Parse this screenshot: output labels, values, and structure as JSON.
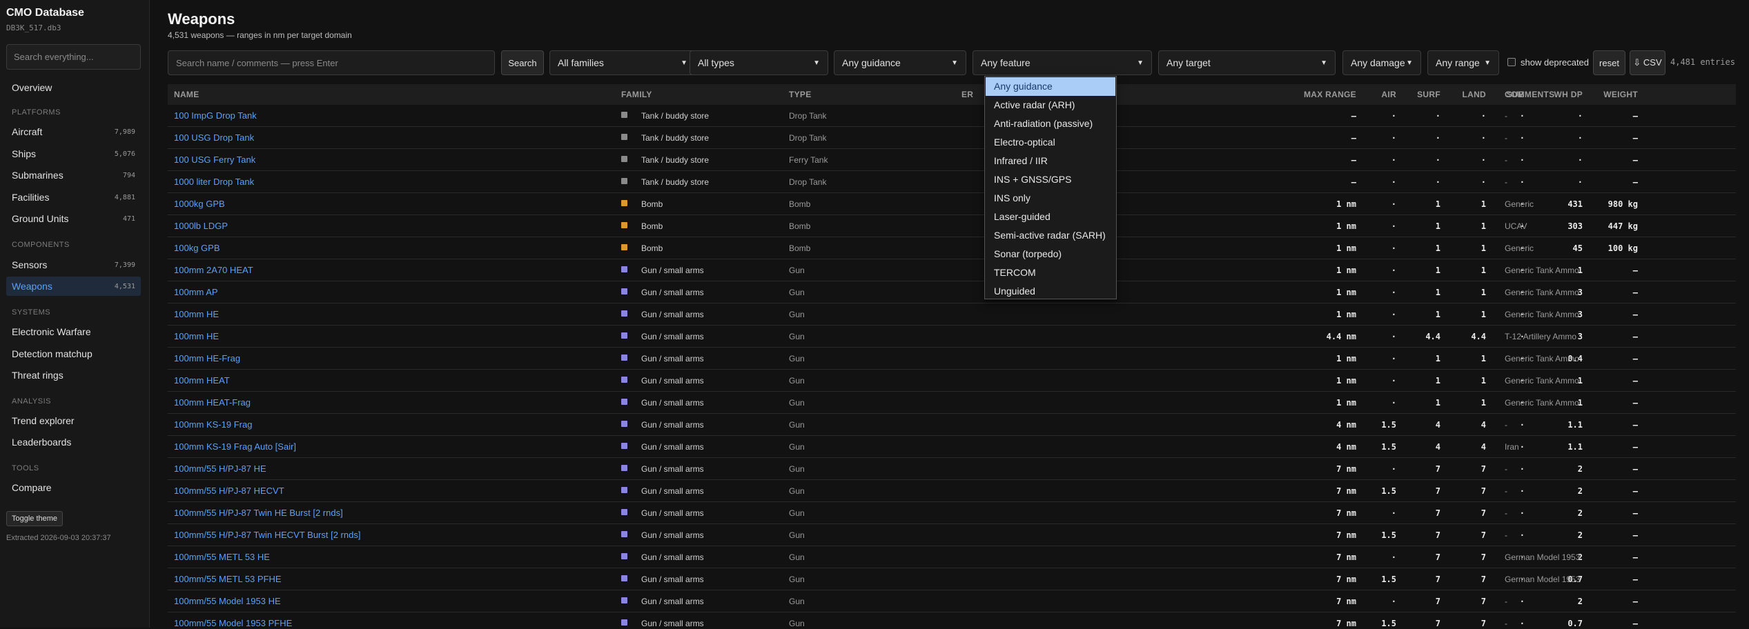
{
  "sidebar": {
    "title": "CMO Database",
    "db_file": "DB3K_517.db3",
    "search_placeholder": "Search everything...",
    "overview": "Overview",
    "sections": {
      "platforms": "PLATFORMS",
      "components": "COMPONENTS",
      "systems": "SYSTEMS",
      "analysis": "ANALYSIS",
      "tools": "TOOLS"
    },
    "items": {
      "aircraft": {
        "label": "Aircraft",
        "count": "7,989"
      },
      "ships": {
        "label": "Ships",
        "count": "5,076"
      },
      "submarines": {
        "label": "Submarines",
        "count": "794"
      },
      "facilities": {
        "label": "Facilities",
        "count": "4,881"
      },
      "ground_units": {
        "label": "Ground Units",
        "count": "471"
      },
      "sensors": {
        "label": "Sensors",
        "count": "7,399"
      },
      "weapons": {
        "label": "Weapons",
        "count": "4,531"
      },
      "electronic_warfare": {
        "label": "Electronic Warfare"
      },
      "detection_matchup": {
        "label": "Detection matchup"
      },
      "threat_rings": {
        "label": "Threat rings"
      },
      "trend_explorer": {
        "label": "Trend explorer"
      },
      "leaderboards": {
        "label": "Leaderboards"
      },
      "compare": {
        "label": "Compare"
      }
    },
    "toggle_theme": "Toggle theme",
    "extracted": "Extracted 2026-09-03 20:37:37"
  },
  "header": {
    "title": "Weapons",
    "subtitle": "4,531 weapons — ranges in nm per target domain"
  },
  "filters": {
    "search_placeholder": "Search name / comments — press Enter",
    "search_button": "Search",
    "family": "All families",
    "type": "All types",
    "guidance": "Any guidance",
    "feature": "Any feature",
    "target": "Any target",
    "damage": "Any damage",
    "range": "Any range",
    "show_deprecated": "show deprecated",
    "reset": "reset",
    "csv": "⇩ CSV",
    "entries": "4,481 entries"
  },
  "guidance_options": [
    "Any guidance",
    "Active radar (ARH)",
    "Anti-radiation (passive)",
    "Electro-optical",
    "Infrared / IIR",
    "INS + GNSS/GPS",
    "INS only",
    "Laser-guided",
    "Semi-active radar (SARH)",
    "Sonar (torpedo)",
    "TERCOM",
    "Unguided"
  ],
  "columns": {
    "name": "NAME",
    "family": "FAMILY",
    "type": "TYPE",
    "min_range_partial": "ER",
    "max_range": "MAX RANGE",
    "air": "AIR",
    "surf": "SURF",
    "land": "LAND",
    "sub": "SUB",
    "wh_dp": "WH DP",
    "weight": "WEIGHT",
    "comments": "COMMENTS"
  },
  "colors": {
    "tank": "#8a8a8a",
    "bomb": "#e0962a",
    "gun": "#8a84e6",
    "accent": "#5aa0ff"
  },
  "rows": [
    {
      "name": "100 ImpG Drop Tank",
      "family": "Tank / buddy store",
      "fam": "tank",
      "type": "Drop Tank",
      "range": "—",
      "air": "·",
      "surf": "·",
      "land": "·",
      "sub": "·",
      "whdp": "·",
      "weight": "—",
      "comments": "-"
    },
    {
      "name": "100 USG Drop Tank",
      "family": "Tank / buddy store",
      "fam": "tank",
      "type": "Drop Tank",
      "range": "—",
      "air": "·",
      "surf": "·",
      "land": "·",
      "sub": "·",
      "whdp": "·",
      "weight": "—",
      "comments": "-"
    },
    {
      "name": "100 USG Ferry Tank",
      "family": "Tank / buddy store",
      "fam": "tank",
      "type": "Ferry Tank",
      "range": "—",
      "air": "·",
      "surf": "·",
      "land": "·",
      "sub": "·",
      "whdp": "·",
      "weight": "—",
      "comments": "-"
    },
    {
      "name": "1000 liter Drop Tank",
      "family": "Tank / buddy store",
      "fam": "tank",
      "type": "Drop Tank",
      "range": "—",
      "air": "·",
      "surf": "·",
      "land": "·",
      "sub": "·",
      "whdp": "·",
      "weight": "—",
      "comments": "-"
    },
    {
      "name": "1000kg GPB",
      "family": "Bomb",
      "fam": "bomb",
      "type": "Bomb",
      "range": "1 nm",
      "air": "·",
      "surf": "1",
      "land": "1",
      "sub": "·",
      "whdp": "431",
      "weight": "980 kg",
      "comments": "Generic"
    },
    {
      "name": "1000lb LDGP",
      "family": "Bomb",
      "fam": "bomb",
      "type": "Bomb",
      "range": "1 nm",
      "air": "·",
      "surf": "1",
      "land": "1",
      "sub": "·",
      "whdp": "303",
      "weight": "447 kg",
      "comments": "UCAV"
    },
    {
      "name": "100kg GPB",
      "family": "Bomb",
      "fam": "bomb",
      "type": "Bomb",
      "range": "1 nm",
      "air": "·",
      "surf": "1",
      "land": "1",
      "sub": "·",
      "whdp": "45",
      "weight": "100 kg",
      "comments": "Generic"
    },
    {
      "name": "100mm 2A70 HEAT",
      "family": "Gun / small arms",
      "fam": "gun",
      "type": "Gun",
      "range": "1 nm",
      "air": "·",
      "surf": "1",
      "land": "1",
      "sub": "·",
      "whdp": "1",
      "weight": "—",
      "comments": "Generic Tank Ammo"
    },
    {
      "name": "100mm AP",
      "family": "Gun / small arms",
      "fam": "gun",
      "type": "Gun",
      "range": "1 nm",
      "air": "·",
      "surf": "1",
      "land": "1",
      "sub": "·",
      "whdp": "3",
      "weight": "—",
      "comments": "Generic Tank Ammo"
    },
    {
      "name": "100mm HE",
      "family": "Gun / small arms",
      "fam": "gun",
      "type": "Gun",
      "range": "1 nm",
      "air": "·",
      "surf": "1",
      "land": "1",
      "sub": "·",
      "whdp": "3",
      "weight": "—",
      "comments": "Generic Tank Ammo"
    },
    {
      "name": "100mm HE",
      "family": "Gun / small arms",
      "fam": "gun",
      "type": "Gun",
      "range": "4.4 nm",
      "air": "·",
      "surf": "4.4",
      "land": "4.4",
      "sub": "·",
      "whdp": "3",
      "weight": "—",
      "comments": "T-12 Artillery Ammo"
    },
    {
      "name": "100mm HE-Frag",
      "family": "Gun / small arms",
      "fam": "gun",
      "type": "Gun",
      "range": "1 nm",
      "air": "·",
      "surf": "1",
      "land": "1",
      "sub": "·",
      "whdp": "0.4",
      "weight": "—",
      "comments": "Generic Tank Ammo"
    },
    {
      "name": "100mm HEAT",
      "family": "Gun / small arms",
      "fam": "gun",
      "type": "Gun",
      "range": "1 nm",
      "air": "·",
      "surf": "1",
      "land": "1",
      "sub": "·",
      "whdp": "1",
      "weight": "—",
      "comments": "Generic Tank Ammo"
    },
    {
      "name": "100mm HEAT-Frag",
      "family": "Gun / small arms",
      "fam": "gun",
      "type": "Gun",
      "range": "1 nm",
      "air": "·",
      "surf": "1",
      "land": "1",
      "sub": "·",
      "whdp": "1",
      "weight": "—",
      "comments": "Generic Tank Ammo"
    },
    {
      "name": "100mm KS-19 Frag",
      "family": "Gun / small arms",
      "fam": "gun",
      "type": "Gun",
      "range": "4 nm",
      "air": "1.5",
      "surf": "4",
      "land": "4",
      "sub": "·",
      "whdp": "1.1",
      "weight": "—",
      "comments": "-"
    },
    {
      "name": "100mm KS-19 Frag Auto [Sair]",
      "family": "Gun / small arms",
      "fam": "gun",
      "type": "Gun",
      "range": "4 nm",
      "air": "1.5",
      "surf": "4",
      "land": "4",
      "sub": "·",
      "whdp": "1.1",
      "weight": "—",
      "comments": "Iran"
    },
    {
      "name": "100mm/55 H/PJ-87 HE",
      "family": "Gun / small arms",
      "fam": "gun",
      "type": "Gun",
      "range": "7 nm",
      "air": "·",
      "surf": "7",
      "land": "7",
      "sub": "·",
      "whdp": "2",
      "weight": "—",
      "comments": "-"
    },
    {
      "name": "100mm/55 H/PJ-87 HECVT",
      "family": "Gun / small arms",
      "fam": "gun",
      "type": "Gun",
      "range": "7 nm",
      "air": "1.5",
      "surf": "7",
      "land": "7",
      "sub": "·",
      "whdp": "2",
      "weight": "—",
      "comments": "-"
    },
    {
      "name": "100mm/55 H/PJ-87 Twin HE Burst [2 rnds]",
      "family": "Gun / small arms",
      "fam": "gun",
      "type": "Gun",
      "range": "7 nm",
      "air": "·",
      "surf": "7",
      "land": "7",
      "sub": "·",
      "whdp": "2",
      "weight": "—",
      "comments": "-"
    },
    {
      "name": "100mm/55 H/PJ-87 Twin HECVT Burst [2 rnds]",
      "family": "Gun / small arms",
      "fam": "gun",
      "type": "Gun",
      "range": "7 nm",
      "air": "1.5",
      "surf": "7",
      "land": "7",
      "sub": "·",
      "whdp": "2",
      "weight": "—",
      "comments": "-"
    },
    {
      "name": "100mm/55 METL 53 HE",
      "family": "Gun / small arms",
      "fam": "gun",
      "type": "Gun",
      "range": "7 nm",
      "air": "·",
      "surf": "7",
      "land": "7",
      "sub": "·",
      "whdp": "2",
      "weight": "—",
      "comments": "German Model 1953"
    },
    {
      "name": "100mm/55 METL 53 PFHE",
      "family": "Gun / small arms",
      "fam": "gun",
      "type": "Gun",
      "range": "7 nm",
      "air": "1.5",
      "surf": "7",
      "land": "7",
      "sub": "·",
      "whdp": "0.7",
      "weight": "—",
      "comments": "German Model 1953"
    },
    {
      "name": "100mm/55 Model 1953 HE",
      "family": "Gun / small arms",
      "fam": "gun",
      "type": "Gun",
      "range": "7 nm",
      "air": "·",
      "surf": "7",
      "land": "7",
      "sub": "·",
      "whdp": "2",
      "weight": "—",
      "comments": "-"
    },
    {
      "name": "100mm/55 Model 1953 PFHE",
      "family": "Gun / small arms",
      "fam": "gun",
      "type": "Gun",
      "range": "7 nm",
      "air": "1.5",
      "surf": "7",
      "land": "7",
      "sub": "·",
      "whdp": "0.7",
      "weight": "—",
      "comments": "-"
    }
  ]
}
